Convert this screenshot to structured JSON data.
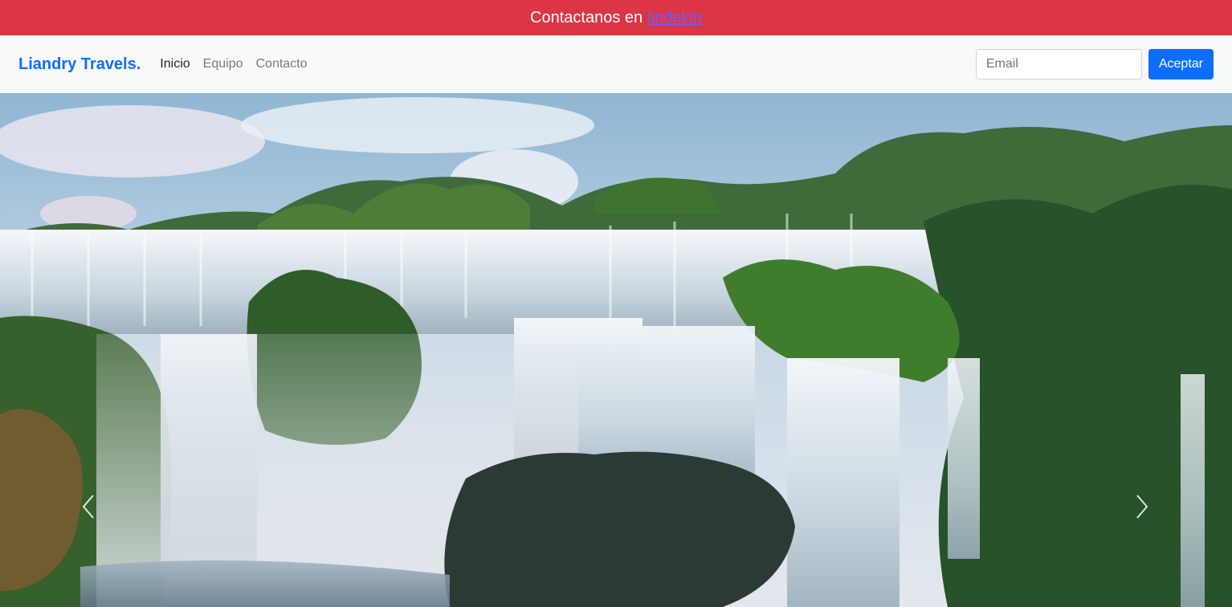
{
  "topbar": {
    "text": "Contactanos en",
    "link_label": "lindekin"
  },
  "navbar": {
    "brand": "Liandry Travels.",
    "links": [
      {
        "label": "Inicio",
        "active": true
      },
      {
        "label": "Equipo",
        "active": false
      },
      {
        "label": "Contacto",
        "active": false
      }
    ],
    "email_placeholder": "Email",
    "email_value": "",
    "accept_label": "Aceptar"
  },
  "carousel": {
    "prev_icon": "chevron-left-icon",
    "next_icon": "chevron-right-icon"
  },
  "colors": {
    "topbar_bg": "#dc3545",
    "brand": "#0d6efd",
    "button_bg": "#0d6efd",
    "navbar_bg": "#f8f9fa"
  }
}
